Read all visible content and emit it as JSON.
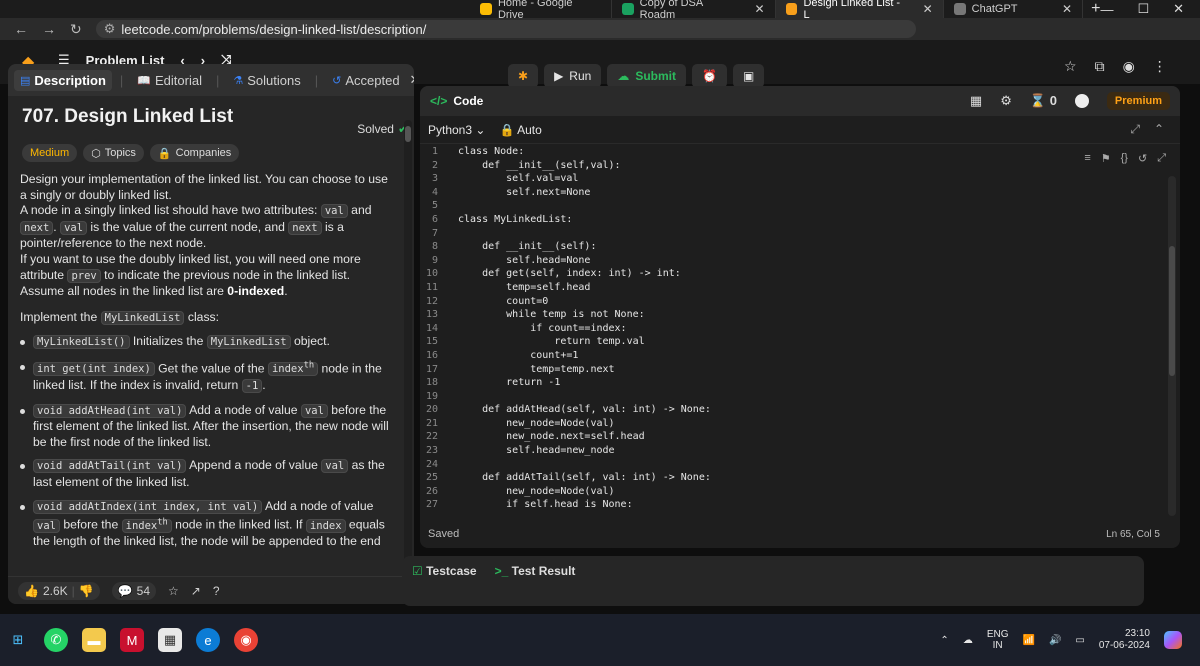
{
  "browser": {
    "tabs": [
      {
        "label": "Home - Google Drive",
        "active": false
      },
      {
        "label": "Copy of DSA Roadm",
        "active": false
      },
      {
        "label": "Design Linked List - L",
        "active": true
      },
      {
        "label": "ChatGPT",
        "active": false
      }
    ],
    "url": "leetcode.com/problems/design-linked-list/description/"
  },
  "topbar": {
    "problem_list": "Problem List",
    "run": "Run",
    "submit": "Submit"
  },
  "left": {
    "tabs": [
      "Description",
      "Editorial",
      "Solutions",
      "Accepted"
    ],
    "title": "707. Design Linked List",
    "solved": "Solved",
    "chips": [
      "Medium",
      "Topics",
      "Companies"
    ],
    "desc": {
      "p1": "Design your implementation of the linked list. You can choose to use a singly or doubly linked list.",
      "p2a": "A node in a singly linked list should have two attributes: ",
      "val": "val",
      "and": " and ",
      "next": "next",
      "p2b": " is the value of the current node, and ",
      "p2c": " is a pointer/reference to the next node.",
      "p3a": "If you want to use the doubly linked list, you will need one more attribute ",
      "prev": "prev",
      "p3b": " to indicate the previous node in the linked list. Assume all nodes in the linked list are ",
      "p3c": "0-indexed",
      "impl_a": "Implement the ",
      "impl_cls": "MyLinkedList",
      "impl_b": " class:",
      "b1_code": "MyLinkedList()",
      "b1_a": " Initializes the ",
      "b1_cls": "MyLinkedList",
      "b1_b": " object.",
      "b2_code": "int get(int index)",
      "b2_a": " Get the value of the ",
      "b2_idx": "index",
      "b2_th": "th",
      "b2_b": " node in the linked list. If the index is invalid, return ",
      "b2_neg": "-1",
      "b3_code": "void addAtHead(int val)",
      "b3_a": " Add a node of value ",
      "b3_b": " before the first element of the linked list. After the insertion, the new node will be the first node of the linked list.",
      "b4_code": "void addAtTail(int val)",
      "b4_a": " Append a node of value ",
      "b4_b": " as the last element of the linked list.",
      "b5_code": "void addAtIndex(int index, int val)",
      "b5_a": " Add a node of value ",
      "b5_b": " before the ",
      "b5_c": " node in the linked list. If ",
      "b5_d": " equals the length of the linked list, the node will be appended to the end"
    },
    "footer": {
      "likes": "2.6K",
      "comments": "54"
    }
  },
  "right": {
    "header": "Code",
    "coins": "0",
    "premium": "Premium",
    "language": "Python3",
    "auto": "Auto",
    "saved": "Saved",
    "cursor": "Ln 65, Col 5",
    "code_lines": [
      {
        "n": "1",
        "t": "class Node:"
      },
      {
        "n": "2",
        "t": "    def __init__(self,val):"
      },
      {
        "n": "3",
        "t": "        self.val=val"
      },
      {
        "n": "4",
        "t": "        self.next=None"
      },
      {
        "n": "5",
        "t": ""
      },
      {
        "n": "6",
        "t": "class MyLinkedList:"
      },
      {
        "n": "7",
        "t": ""
      },
      {
        "n": "8",
        "t": "    def __init__(self):"
      },
      {
        "n": "9",
        "t": "        self.head=None"
      },
      {
        "n": "10",
        "t": "    def get(self, index: int) -> int:"
      },
      {
        "n": "11",
        "t": "        temp=self.head"
      },
      {
        "n": "12",
        "t": "        count=0"
      },
      {
        "n": "13",
        "t": "        while temp is not None:"
      },
      {
        "n": "14",
        "t": "            if count==index:"
      },
      {
        "n": "15",
        "t": "                return temp.val"
      },
      {
        "n": "16",
        "t": "            count+=1"
      },
      {
        "n": "17",
        "t": "            temp=temp.next"
      },
      {
        "n": "18",
        "t": "        return -1"
      },
      {
        "n": "19",
        "t": ""
      },
      {
        "n": "20",
        "t": "    def addAtHead(self, val: int) -> None:"
      },
      {
        "n": "21",
        "t": "        new_node=Node(val)"
      },
      {
        "n": "22",
        "t": "        new_node.next=self.head"
      },
      {
        "n": "23",
        "t": "        self.head=new_node"
      },
      {
        "n": "24",
        "t": ""
      },
      {
        "n": "25",
        "t": "    def addAtTail(self, val: int) -> None:"
      },
      {
        "n": "26",
        "t": "        new_node=Node(val)"
      },
      {
        "n": "27",
        "t": "        if self.head is None:"
      }
    ]
  },
  "test": {
    "tab1": "Testcase",
    "tab2": "Test Result"
  },
  "taskbar": {
    "lang1": "ENG",
    "lang2": "IN",
    "time": "23:10",
    "date": "07-06-2024"
  }
}
